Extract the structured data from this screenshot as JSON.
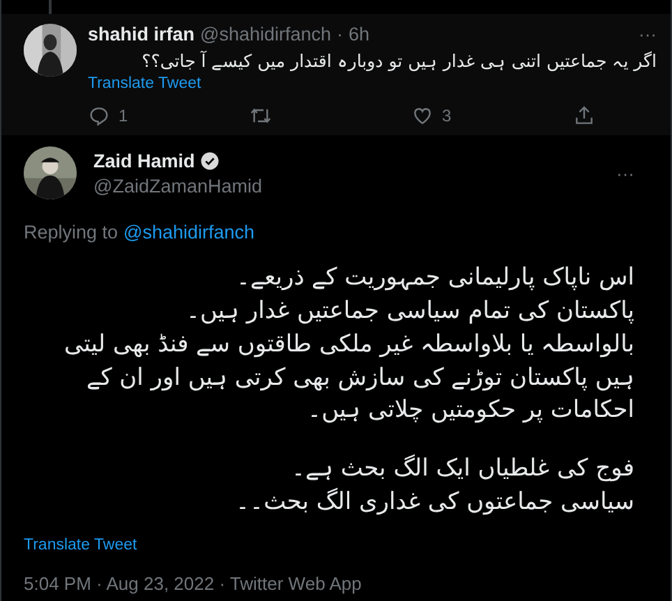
{
  "reply_tweet": {
    "name": "shahid irfan",
    "handle": "@shahidirfanch",
    "separator": "·",
    "time": "6h",
    "more": "···",
    "text": "اگر یہ جماعتیں اتنی ہی غدار ہیں تو دوبارہ اقتدار میں کیسے آ جاتی؟؟",
    "translate": "Translate Tweet",
    "reply_count": "1",
    "like_count": "3"
  },
  "main_tweet": {
    "name": "Zaid Hamid",
    "verified": true,
    "handle": "@ZaidZamanHamid",
    "more": "···",
    "replying_label": "Replying to",
    "replying_handle": "@shahidirfanch",
    "paragraphs": [
      "اس ناپاک پارلیمانی جمہوریت کے ذریعے۔\nپاکستان کی تمام سیاسی جماعتیں غدار ہیں۔\nبالواسطہ یا بلاواسطہ غیر ملکی طاقتوں سے فنڈ بھی لیتی ہیں پاکستان توڑنے کی سازش بھی کرتی ہیں اور ان کے احکامات پر حکومتیں چلاتی ہیں۔",
      "فوج کی غلطیاں ایک الگ بحث ہے۔\nسیاسی جماعتوں کی غداری الگ بحث۔۔"
    ],
    "translate": "Translate Tweet",
    "timestamp": "5:04 PM · Aug 23, 2022 · Twitter Web App"
  }
}
